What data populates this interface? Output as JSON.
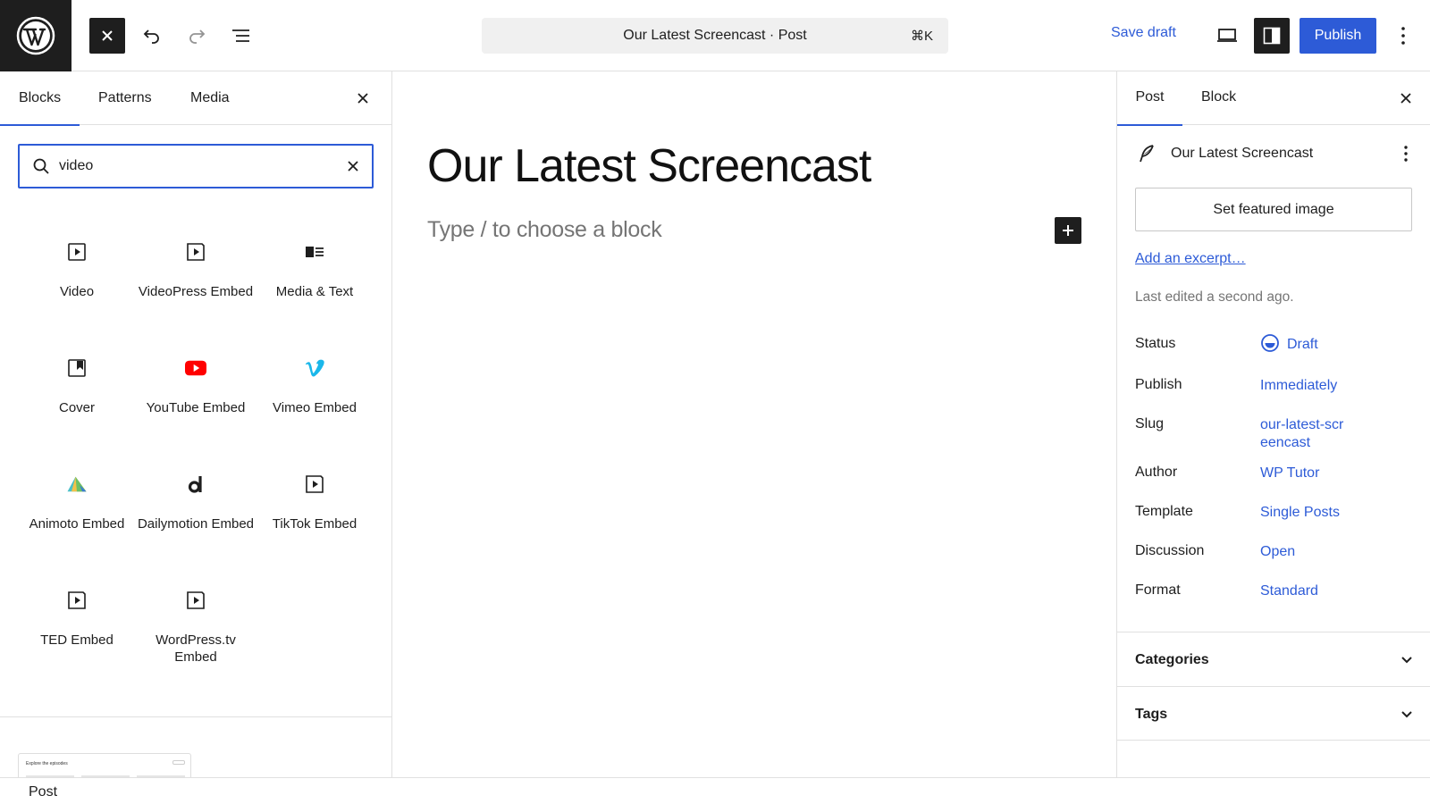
{
  "toolbar": {
    "logo_icon": "wordpress-logo",
    "close_icon": "close-icon",
    "undo_icon": "undo-icon",
    "redo_icon": "redo-icon",
    "document_overview_icon": "list-view-icon",
    "command_title": "Our Latest Screencast · Post",
    "command_shortcut": "⌘K",
    "save_draft_label": "Save draft",
    "view_icon": "desktop-preview-icon",
    "settings_icon": "sidebar-settings-icon",
    "publish_label": "Publish",
    "more_icon": "more-vertical-icon",
    "accent_color": "#2d5bd7"
  },
  "inserter": {
    "tabs": [
      {
        "label": "Blocks",
        "active": true
      },
      {
        "label": "Patterns",
        "active": false
      },
      {
        "label": "Media",
        "active": false
      }
    ],
    "search": {
      "value": "video",
      "placeholder": "Search"
    },
    "blocks": [
      {
        "label": "Video",
        "icon": "video-icon"
      },
      {
        "label": "VideoPress Embed",
        "icon": "embed-video-icon"
      },
      {
        "label": "Media & Text",
        "icon": "media-text-icon"
      },
      {
        "label": "Cover",
        "icon": "cover-icon"
      },
      {
        "label": "YouTube Embed",
        "icon": "youtube-icon"
      },
      {
        "label": "Vimeo Embed",
        "icon": "vimeo-icon"
      },
      {
        "label": "Animoto Embed",
        "icon": "animoto-icon"
      },
      {
        "label": "Dailymotion Embed",
        "icon": "dailymotion-icon"
      },
      {
        "label": "TikTok Embed",
        "icon": "embed-video-icon"
      },
      {
        "label": "TED Embed",
        "icon": "embed-video-icon"
      },
      {
        "label": "WordPress.tv Embed",
        "icon": "embed-video-icon"
      }
    ],
    "pattern_preview_text": "Explore the episodes"
  },
  "canvas": {
    "post_title": "Our Latest Screencast",
    "block_placeholder": "Type / to choose a block"
  },
  "settings": {
    "tabs": [
      {
        "label": "Post",
        "active": true
      },
      {
        "label": "Block",
        "active": false
      }
    ],
    "document_title": "Our Latest Screencast",
    "featured_image_label": "Set featured image",
    "excerpt_link": "Add an excerpt…",
    "last_edited": "Last edited a second ago.",
    "meta": [
      {
        "label": "Status",
        "value": "Draft"
      },
      {
        "label": "Publish",
        "value": "Immediately"
      },
      {
        "label": "Slug",
        "value": "our-latest-screencast"
      },
      {
        "label": "Author",
        "value": "WP Tutor"
      },
      {
        "label": "Template",
        "value": "Single Posts"
      },
      {
        "label": "Discussion",
        "value": "Open"
      },
      {
        "label": "Format",
        "value": "Standard"
      }
    ],
    "sections": [
      {
        "title": "Categories",
        "expanded": false
      },
      {
        "title": "Tags",
        "expanded": false
      }
    ]
  },
  "footer": {
    "breadcrumb": "Post"
  }
}
